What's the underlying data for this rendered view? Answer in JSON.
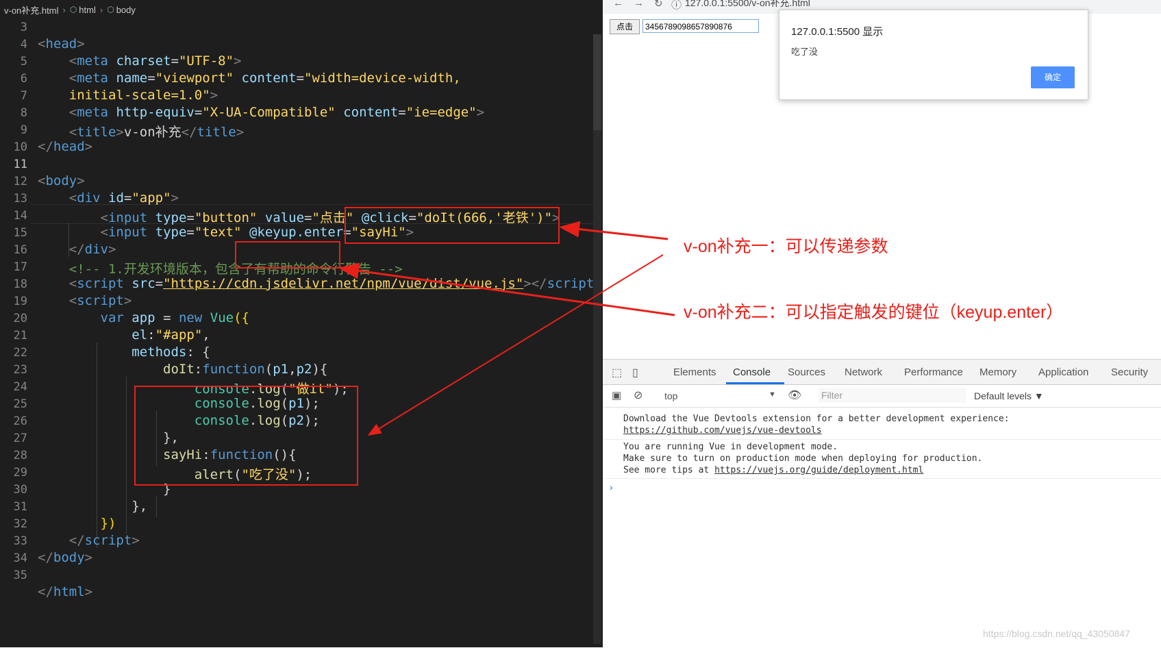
{
  "editor": {
    "breadcrumb": {
      "file": "v-on补充.html",
      "crumb1": "html",
      "crumb2": "body"
    },
    "line_numbers": [
      "3",
      "4",
      "5",
      "6",
      "7",
      "8",
      "9",
      "10",
      "11",
      "12",
      "13",
      "14",
      "15",
      "16",
      "17",
      "18",
      "19",
      "20",
      "21",
      "22",
      "23",
      "24",
      "25",
      "26",
      "27",
      "28",
      "29",
      "30",
      "31",
      "32",
      "33",
      "34",
      "35"
    ],
    "current_line": "11"
  },
  "browser": {
    "url": "127.0.0.1:5500/v-on补充.html",
    "button_label": "点击",
    "text_input_value": "3456789098657890876",
    "dialog": {
      "title": "127.0.0.1:5500 显示",
      "message": "吃了没",
      "ok_label": "确定"
    }
  },
  "annotations": {
    "one": "v-on补充一：可以传递参数",
    "two": "v-on补充二：可以指定触发的键位（keyup.enter）",
    "color": "#e8201a"
  },
  "devtools": {
    "tabs": [
      "Elements",
      "Console",
      "Sources",
      "Network",
      "Performance",
      "Memory",
      "Application",
      "Security"
    ],
    "active_tab": "Console",
    "context": "top",
    "filter_placeholder": "Filter",
    "levels": "Default levels ▼",
    "messages": {
      "m1": "Download the Vue Devtools extension for a better development experience:",
      "m1_link": "https://github.com/vuejs/vue-devtools",
      "m2": "You are running Vue in development mode.",
      "m3": "Make sure to turn on production mode when deploying for production.",
      "m4": "See more tips at ",
      "m4_link": "https://vuejs.org/guide/deployment.html"
    },
    "prompt": "›"
  },
  "watermark": "https://blog.csdn.net/qq_43050847"
}
